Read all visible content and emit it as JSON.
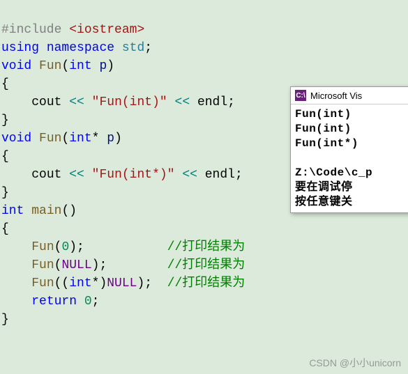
{
  "code": {
    "include_directive": "#include",
    "include_header": "<iostream>",
    "kw_using": "using",
    "kw_namespace": "namespace",
    "ns_std": "std",
    "kw_void": "void",
    "func_Fun": "Fun",
    "kw_int": "int",
    "param_p": "p",
    "id_cout": "cout",
    "op_ins": "<<",
    "str_fun_int": "\"Fun(int)\"",
    "str_fun_intptr": "\"Fun(int*)\"",
    "id_endl": "endl",
    "kw_return": "return",
    "func_main": "main",
    "num_zero": "0",
    "macro_null": "NULL",
    "cmt1": "//打印结果为",
    "cmt2": "//打印结果为",
    "cmt3": "//打印结果为",
    "brace_open": "{",
    "brace_close": "}",
    "semi": ";"
  },
  "console": {
    "title": "Microsoft Vis",
    "icon_label": "C:\\",
    "lines": {
      "l1": "Fun(int)",
      "l2": "Fun(int)",
      "l3": "Fun(int*)",
      "l4": "",
      "l5": "Z:\\Code\\c_p",
      "l6": "要在调试停",
      "l7": "按任意键关"
    }
  },
  "watermark": "CSDN @小小unicorn"
}
